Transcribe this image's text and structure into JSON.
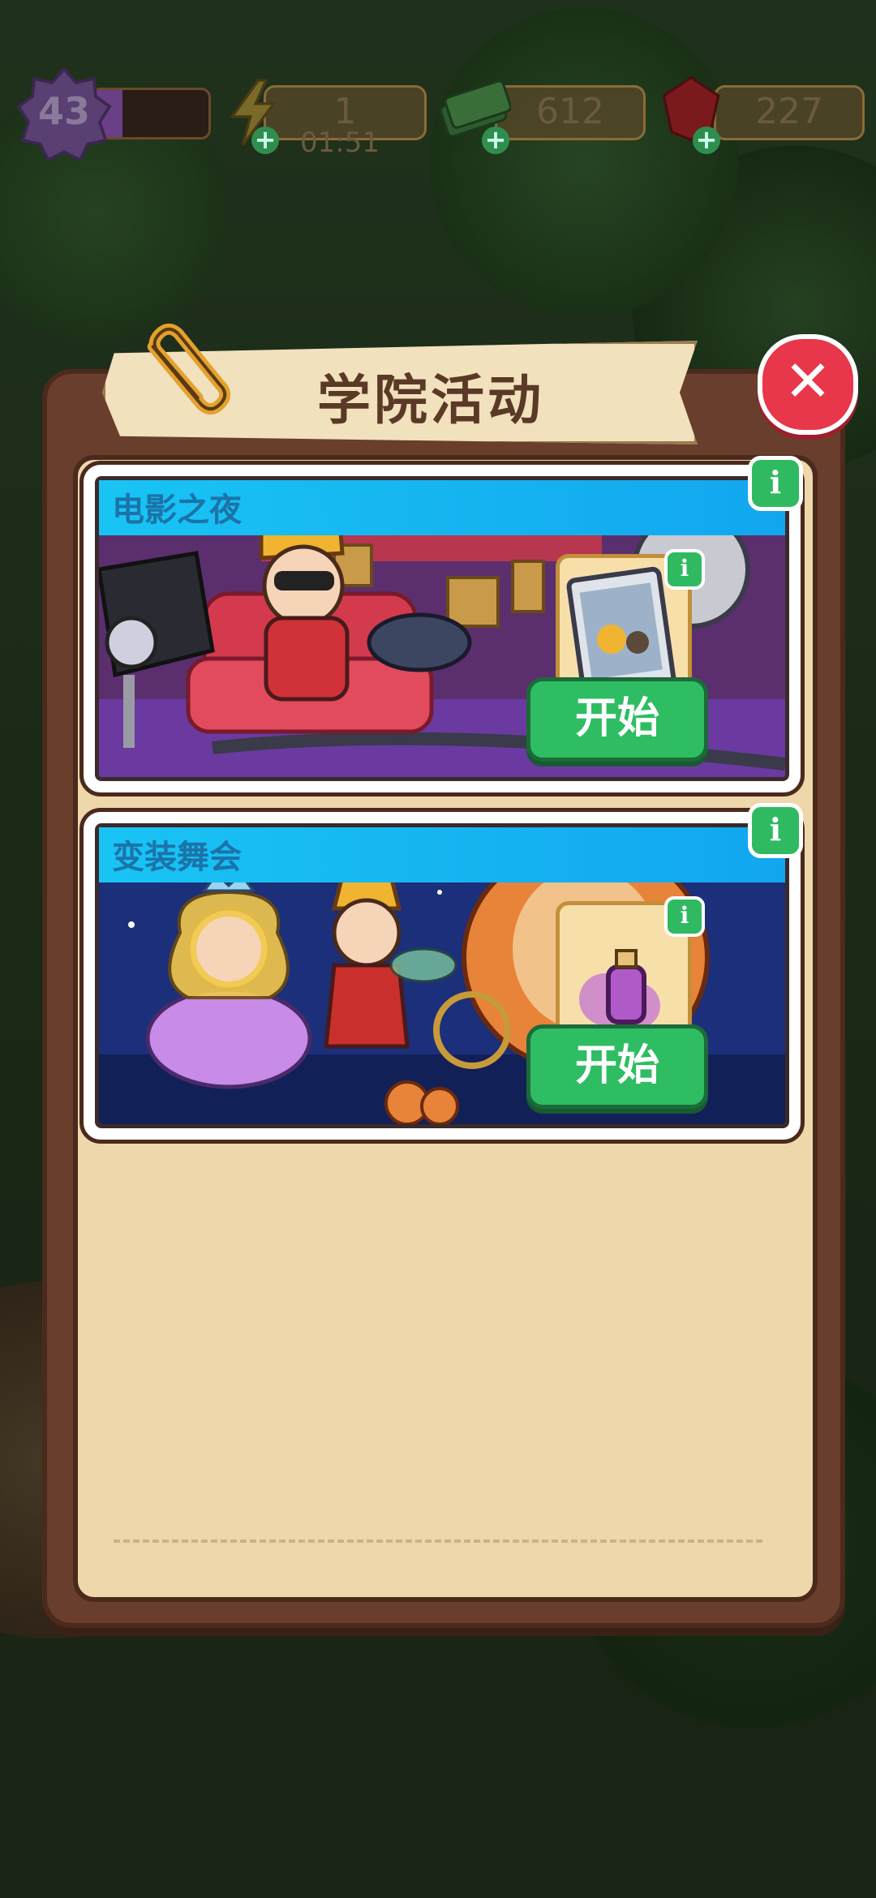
{
  "hud": {
    "level": "43",
    "xp_progress": 0.25,
    "energy_value": "1",
    "energy_timer": "01:51",
    "cash_value": "612",
    "gems_value": "227",
    "plus_symbol": "+"
  },
  "dialog": {
    "title": "学院活动",
    "close_symbol": "✕"
  },
  "events": [
    {
      "title": "电影之夜",
      "start_label": "开始",
      "info_symbol": "i",
      "reward_icon": "movie-poster-icon",
      "scene_colors": {
        "bg": "#5b2f6e",
        "sofa": "#d43a4e"
      }
    },
    {
      "title": "变装舞会",
      "start_label": "开始",
      "info_symbol": "i",
      "reward_icon": "perfume-bottle-icon",
      "scene_colors": {
        "bg": "#1b2f7a",
        "carriage": "#e8833a"
      }
    }
  ],
  "colors": {
    "panel": "#6a3e2c",
    "panel_inner": "#efd7ac",
    "header_blue": "#19c4f4",
    "button_green": "#2fbd63",
    "close_red": "#e8364a"
  }
}
